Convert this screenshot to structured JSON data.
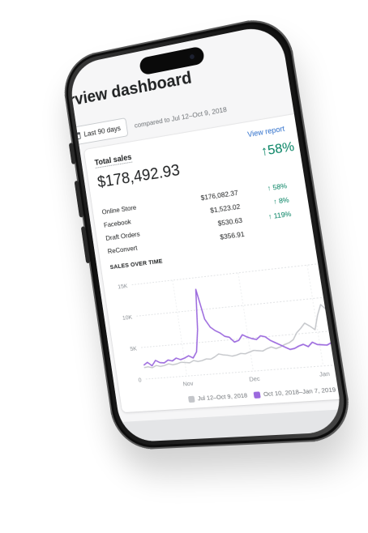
{
  "page": {
    "title": "verview dashboard"
  },
  "filters": {
    "date_range_label": "Last 90 days",
    "compare_label": "compared to Jul 12–Oct 9, 2018"
  },
  "total_sales_card": {
    "title": "Total sales",
    "view_report_label": "View report",
    "total": "$178,492.93",
    "growth": "↑58%",
    "breakdown": [
      {
        "name": "Online Store",
        "value": "$176,082.37",
        "change": "↑ 58%"
      },
      {
        "name": "Facebook",
        "value": "$1,523.02",
        "change": "↑ 8%"
      },
      {
        "name": "Draft Orders",
        "value": "$530.63",
        "change": "↑ 119%"
      },
      {
        "name": "ReConvert",
        "value": "$356.91",
        "change": ""
      }
    ]
  },
  "chart_data": {
    "type": "line",
    "title": "SALES OVER TIME",
    "xlabel": "",
    "ylabel": "",
    "x_ticks": [
      "Nov",
      "Dec",
      "Jan"
    ],
    "y_ticks": [
      "0",
      "5K",
      "10K",
      "15K"
    ],
    "ylim": [
      0,
      15000
    ],
    "x": [
      0,
      1,
      2,
      3,
      4,
      5,
      6,
      7,
      8,
      9,
      10,
      11,
      12,
      13,
      14,
      15,
      16,
      17,
      18,
      19,
      20,
      21,
      22,
      23,
      24,
      25,
      26,
      27,
      28,
      29,
      30,
      31,
      32,
      33,
      34,
      35,
      36,
      37,
      38,
      39,
      40,
      41,
      42,
      43,
      44,
      45
    ],
    "series": [
      {
        "name": "Jul 12–Oct 9, 2018",
        "color": "#c4c6ca",
        "values": [
          1800,
          1900,
          1700,
          2000,
          1800,
          1900,
          2100,
          1900,
          2000,
          2200,
          2100,
          2000,
          2300,
          2100,
          2200,
          2400,
          2300,
          2600,
          3000,
          2800,
          2700,
          2500,
          2600,
          2800,
          2700,
          2900,
          3100,
          3000,
          2900,
          3200,
          3400,
          3100,
          3300,
          3600,
          3800,
          4200,
          5200,
          5800,
          6500,
          6000,
          5400,
          7500,
          9000,
          8200,
          6500,
          5000
        ]
      },
      {
        "name": "Oct 10, 2018–Jan 7, 2019",
        "color": "#9c6ade",
        "values": [
          2200,
          2600,
          2000,
          2800,
          2400,
          2300,
          2700,
          2500,
          2900,
          2600,
          2800,
          3100,
          2700,
          3600,
          7000,
          13200,
          8500,
          7200,
          6600,
          6200,
          5600,
          5400,
          4600,
          4800,
          5600,
          5200,
          4900,
          4700,
          5200,
          5000,
          4400,
          4000,
          3600,
          3200,
          2800,
          2900,
          3200,
          3400,
          3000,
          3600,
          3200,
          3100,
          3000,
          3300,
          3000,
          2900
        ]
      }
    ]
  }
}
